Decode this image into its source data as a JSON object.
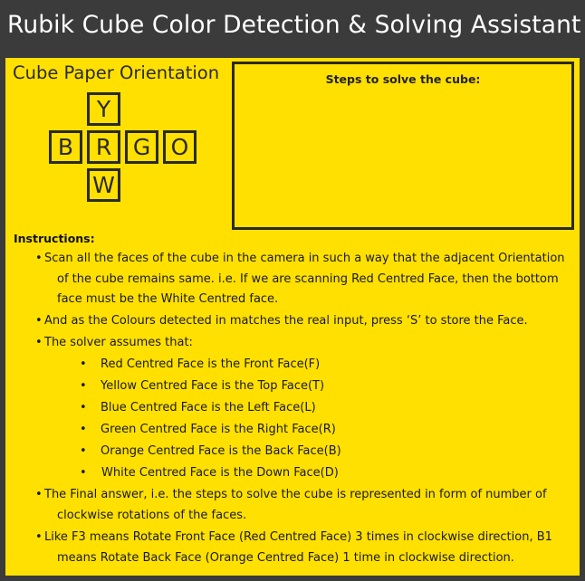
{
  "window": {
    "title": "Rubik Cube Color Detection & Solving Assistant"
  },
  "orientation": {
    "title": "Cube Paper Orientation",
    "faces": {
      "top": "Y",
      "left": "B",
      "center": "R",
      "right": "G",
      "back": "O",
      "bottom": "W"
    }
  },
  "steps": {
    "title": "Steps to solve the cube:"
  },
  "instructions": {
    "heading": "Instructions:",
    "bullet": "•",
    "item1": [
      "Scan all the faces of the cube in the camera in such a way that the adjacent Orientation",
      "of the cube remains same. i.e. If we are scanning Red Centred Face, then the bottom",
      "face must be the White Centred face."
    ],
    "item2": "And as the Colours detected in matches the real input, press ‘S’ to store the Face.",
    "item3": "The  solver assumes that:",
    "sub": [
      "Red Centred Face is the Front Face(F)",
      "Yellow Centred Face is the Top Face(T)",
      "Blue Centred Face is the Left Face(L)",
      "Green Centred Face is the Right Face(R)",
      "Orange Centred Face is the Back Face(B)",
      "White Centred Face is the Down Face(D)"
    ],
    "item4": [
      "The Final answer, i.e. the steps to solve the cube is represented in form of number of",
      "clockwise rotations of the faces."
    ],
    "item5": [
      "Like F3 means Rotate Front Face (Red Centred Face) 3 times in clockwise direction, B1",
      "means Rotate Back Face (Orange Centred Face) 1 time in clockwise direction."
    ]
  }
}
